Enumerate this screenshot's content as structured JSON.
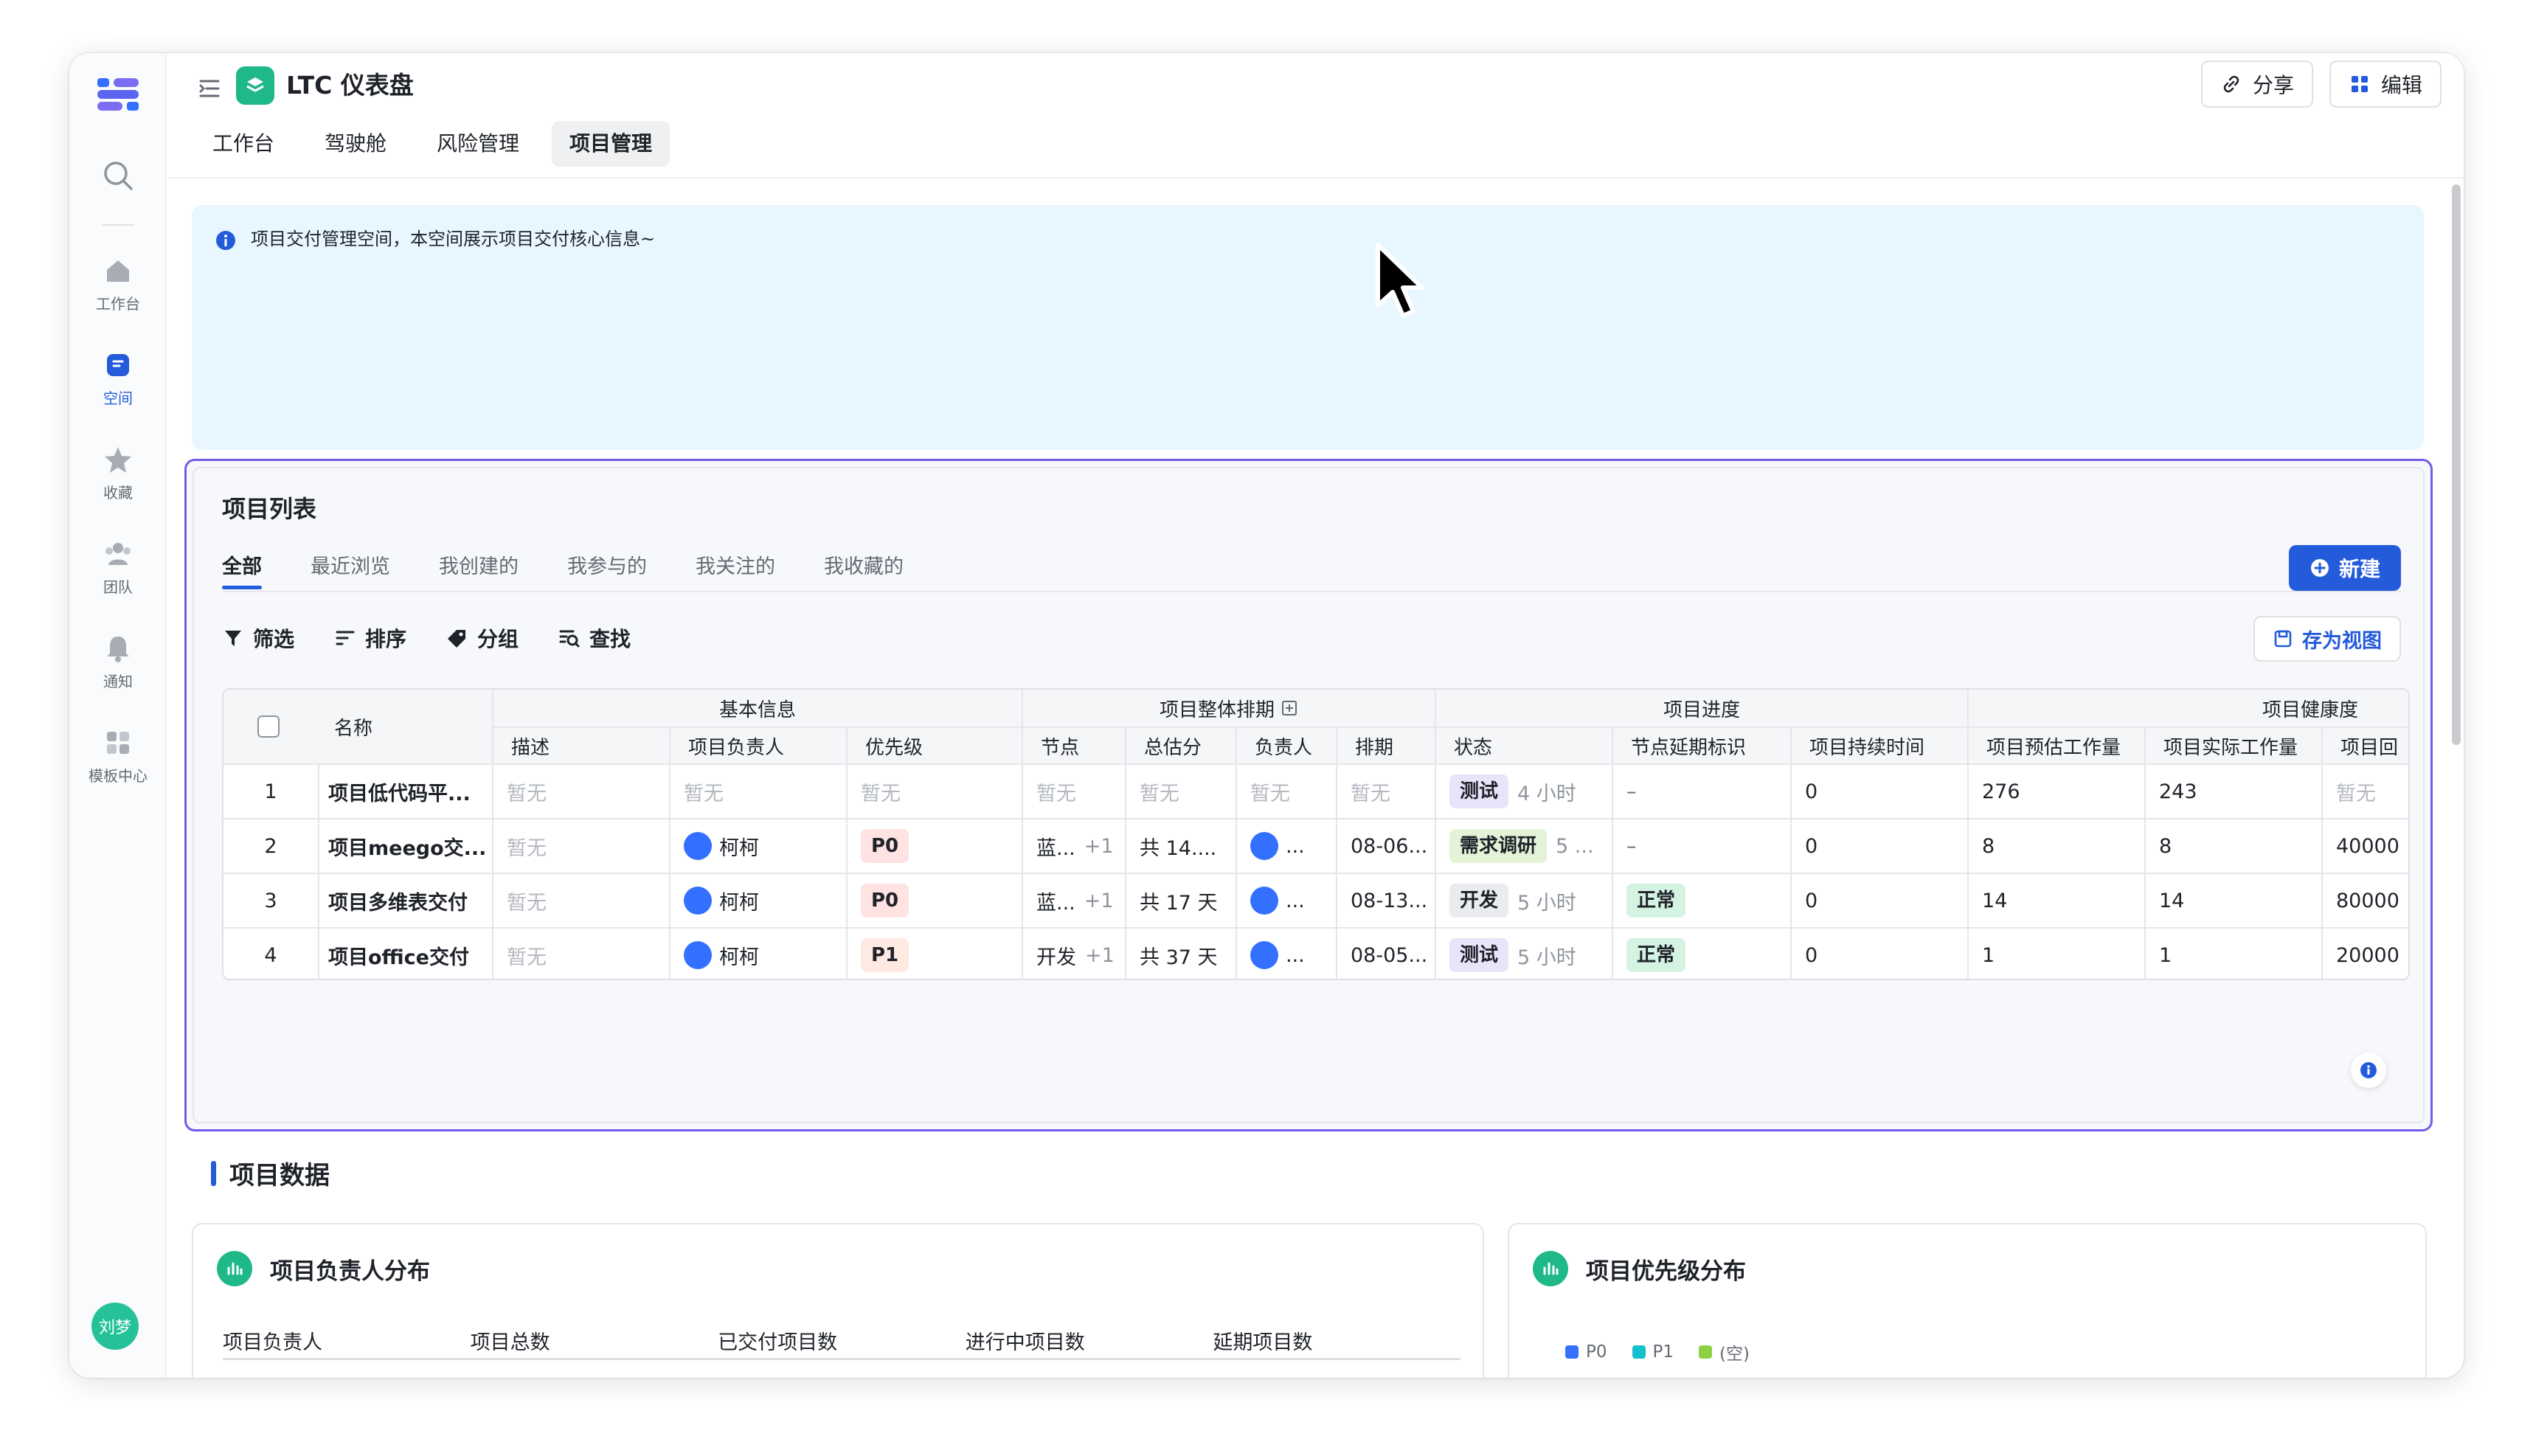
{
  "app": {
    "title": "LTC 仪表盘",
    "share_label": "分享",
    "edit_label": "编辑"
  },
  "rail": {
    "items": [
      {
        "label": "工作台",
        "icon": "home-icon"
      },
      {
        "label": "空间",
        "icon": "space-icon"
      },
      {
        "label": "收藏",
        "icon": "star-icon"
      },
      {
        "label": "团队",
        "icon": "team-icon"
      },
      {
        "label": "通知",
        "icon": "bell-icon"
      },
      {
        "label": "模板中心",
        "icon": "template-icon"
      }
    ],
    "avatar_label": "刘梦"
  },
  "tabs": [
    {
      "label": "工作台"
    },
    {
      "label": "驾驶舱"
    },
    {
      "label": "风险管理"
    },
    {
      "label": "项目管理"
    }
  ],
  "notice": {
    "text": "项目交付管理空间，本空间展示项目交付核心信息~"
  },
  "project_list": {
    "title": "项目列表",
    "subtabs": [
      "全部",
      "最近浏览",
      "我创建的",
      "我参与的",
      "我关注的",
      "我收藏的"
    ],
    "new_label": "新建",
    "tools": [
      "筛选",
      "排序",
      "分组",
      "查找"
    ],
    "save_view_label": "存为视图",
    "groups": [
      "基本信息",
      "项目整体排期",
      "项目进度",
      "项目健康度"
    ],
    "columns": {
      "name": "名称",
      "desc": "描述",
      "owner": "项目负责人",
      "priority": "优先级",
      "node": "节点",
      "estimate": "总估分",
      "assignee": "负责人",
      "schedule": "排期",
      "status": "状态",
      "delay": "节点延期标识",
      "duration": "项目持续时间",
      "est_work": "项目预估工作量",
      "act_work": "项目实际工作量",
      "ret": "项目回"
    },
    "empty_text": "暂无",
    "rows": [
      {
        "idx": "1",
        "name": "项目低代码平...",
        "desc": "暂无",
        "owner": "",
        "priority": "",
        "node": "",
        "node_more": "",
        "estimate": "",
        "assignee": "",
        "schedule": "",
        "status": "测试",
        "status_time": "4 小时",
        "delay": "–",
        "duration": "0",
        "est_work": "276",
        "act_work": "243",
        "ret": ""
      },
      {
        "idx": "2",
        "name": "项目meego交...",
        "desc": "暂无",
        "owner": "柯柯",
        "priority": "P0",
        "node": "蓝...",
        "node_more": "+1",
        "estimate": "共 14....",
        "assignee": "...",
        "schedule": "08-06...",
        "status": "需求调研",
        "status_time": "5 ...",
        "delay": "–",
        "duration": "0",
        "est_work": "8",
        "act_work": "8",
        "ret": "40000"
      },
      {
        "idx": "3",
        "name": "项目多维表交付",
        "desc": "暂无",
        "owner": "柯柯",
        "priority": "P0",
        "node": "蓝...",
        "node_more": "+1",
        "estimate": "共 17 天",
        "assignee": "...",
        "schedule": "08-13...",
        "status": "开发",
        "status_time": "5 小时",
        "delay": "正常",
        "duration": "0",
        "est_work": "14",
        "act_work": "14",
        "ret": "80000"
      },
      {
        "idx": "4",
        "name": "项目office交付",
        "desc": "暂无",
        "owner": "柯柯",
        "priority": "P1",
        "node": "开发",
        "node_more": "+1",
        "estimate": "共 37 天",
        "assignee": "...",
        "schedule": "08-05...",
        "status": "测试",
        "status_time": "5 小时",
        "delay": "正常",
        "duration": "0",
        "est_work": "1",
        "act_work": "1",
        "ret": "20000"
      }
    ]
  },
  "project_data": {
    "title": "项目数据",
    "owner_card": {
      "title": "项目负责人分布",
      "columns": [
        "项目负责人",
        "项目总数",
        "已交付项目数",
        "进行中项目数",
        "延期项目数"
      ]
    },
    "priority_card": {
      "title": "项目优先级分布",
      "legend": [
        {
          "label": "P0",
          "color": "#3370ff"
        },
        {
          "label": "P1",
          "color": "#14c0d0"
        },
        {
          "label": "(空)",
          "color": "#8ed142"
        }
      ]
    }
  },
  "colors": {
    "accent": "#245bdb",
    "panel_border": "#6e5de8",
    "notice_bg": "#e8f7ff"
  }
}
